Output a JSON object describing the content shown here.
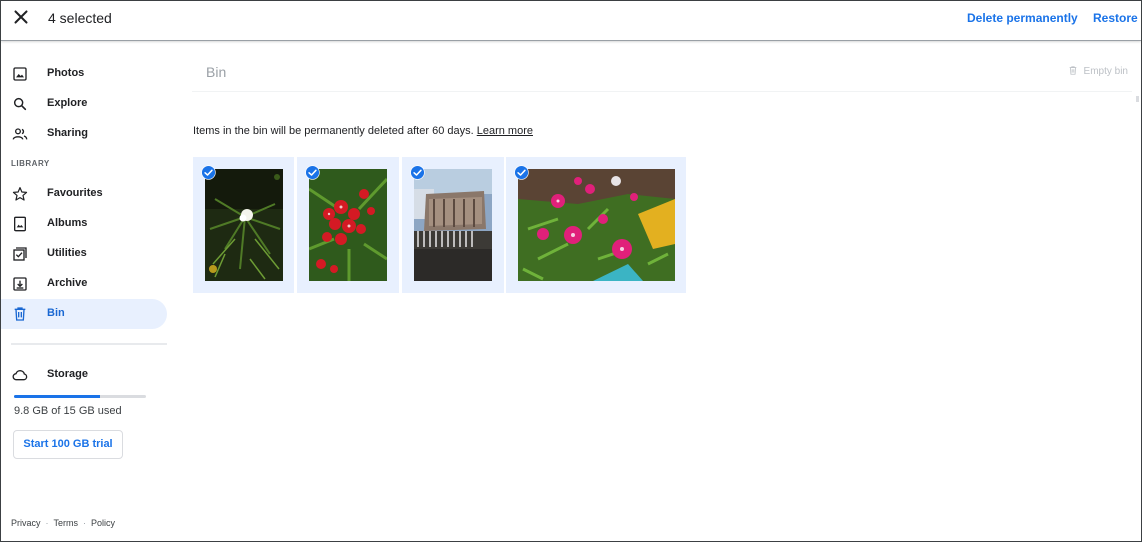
{
  "topbar": {
    "selected_label": "4 selected",
    "delete_label": "Delete permanently",
    "restore_label": "Restore"
  },
  "sidebar": {
    "items_primary": [
      {
        "label": "Photos",
        "icon": "photo-icon"
      },
      {
        "label": "Explore",
        "icon": "search-icon"
      },
      {
        "label": "Sharing",
        "icon": "people-icon"
      }
    ],
    "section_label": "LIBRARY",
    "items_library": [
      {
        "label": "Favourites",
        "icon": "star-icon"
      },
      {
        "label": "Albums",
        "icon": "album-icon"
      },
      {
        "label": "Utilities",
        "icon": "checklist-icon"
      },
      {
        "label": "Archive",
        "icon": "archive-icon"
      },
      {
        "label": "Bin",
        "icon": "trash-icon",
        "active": true
      }
    ],
    "storage": {
      "label": "Storage",
      "usage_text": "9.8 GB of 15 GB used",
      "used_fraction": 0.65,
      "trial_button": "Start 100 GB trial"
    },
    "footer": [
      "Privacy",
      "Terms",
      "Policy"
    ]
  },
  "main": {
    "title": "Bin",
    "empty_bin_label": "Empty bin",
    "info_text": "Items in the bin will be permanently deleted after 60 days.",
    "learn_more": "Learn more",
    "photos": [
      {
        "subject": "white flower dark foliage",
        "selected": true
      },
      {
        "subject": "red flowers",
        "selected": true
      },
      {
        "subject": "building with fence",
        "selected": true
      },
      {
        "subject": "pink flowers garden",
        "selected": true
      }
    ]
  },
  "colors": {
    "accent": "#1a73e8",
    "selection_bg": "#e8f0fe",
    "active_nav_text": "#1967d2"
  }
}
